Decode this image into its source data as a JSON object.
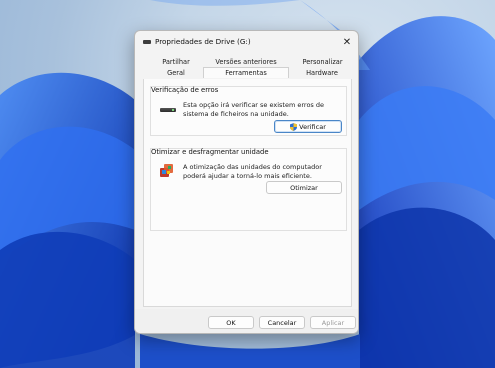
{
  "window": {
    "title": "Propriedades de Drive (G:)"
  },
  "tabs": {
    "row1": [
      "Partilhar",
      "Versões anteriores",
      "Personalizar"
    ],
    "row2": [
      "Geral",
      "Ferramentas",
      "Hardware"
    ],
    "active": "Ferramentas"
  },
  "error_check": {
    "title": "Verificação de erros",
    "description": "Esta opção irá verificar se existem erros de sistema de ficheiros na unidade.",
    "button": "Verificar"
  },
  "optimize": {
    "title": "Otimizar e desfragmentar unidade",
    "description": "A otimização das unidades do computador poderá ajudar a torná-lo mais eficiente.",
    "button": "Otimizar"
  },
  "footer": {
    "ok": "OK",
    "cancel": "Cancelar",
    "apply": "Aplicar"
  },
  "icons": {
    "close": "close-icon",
    "drive": "drive-icon",
    "shield": "uac-shield-icon",
    "defrag": "defrag-icon"
  },
  "colors": {
    "accent": "#4a86c7",
    "wallpaper_blue": "#1f5fd6"
  }
}
